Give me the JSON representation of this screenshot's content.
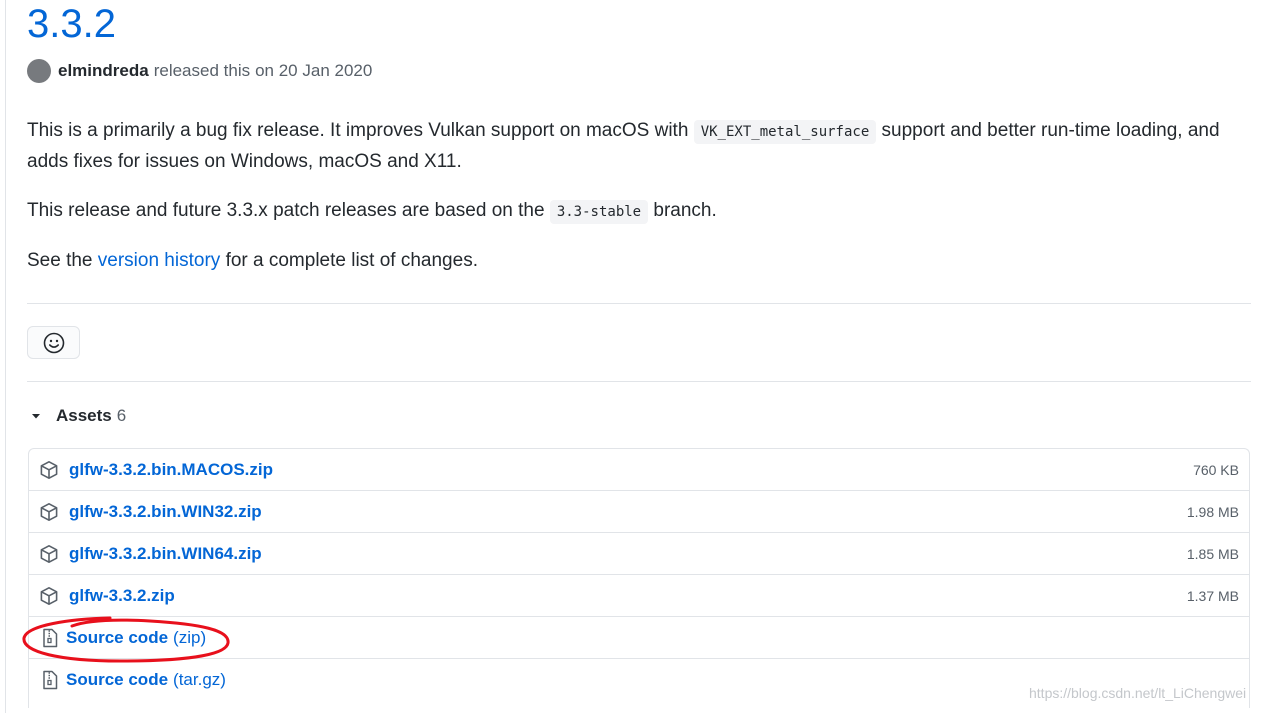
{
  "release": {
    "title": "3.3.2",
    "author": "elmindreda",
    "released_text": "released this",
    "released_date": "on 20 Jan 2020"
  },
  "notes": {
    "p1_before": "This is a primarily a bug fix release. It improves Vulkan support on macOS with",
    "p1_code": "VK_EXT_metal_surface",
    "p1_after": "support and better run-time loading, and adds fixes for issues on Windows, macOS and X11.",
    "p2_before": "This release and future 3.3.x patch releases are based on the",
    "p2_code": "3.3-stable",
    "p2_after": "branch.",
    "p3_before": "See the",
    "p3_link": "version history",
    "p3_after": "for a complete list of changes."
  },
  "assets": {
    "title": "Assets",
    "count": "6",
    "items": [
      {
        "name": "glfw-3.3.2.bin.MACOS.zip",
        "size": "760 KB",
        "icon": "package-icon"
      },
      {
        "name": "glfw-3.3.2.bin.WIN32.zip",
        "size": "1.98 MB",
        "icon": "package-icon"
      },
      {
        "name": "glfw-3.3.2.bin.WIN64.zip",
        "size": "1.85 MB",
        "icon": "package-icon"
      },
      {
        "name": "glfw-3.3.2.zip",
        "size": "1.37 MB",
        "icon": "package-icon"
      }
    ],
    "source": [
      {
        "name": "Source code",
        "ext": "(zip)",
        "icon": "file-zip-icon"
      },
      {
        "name": "Source code",
        "ext": "(tar.gz)",
        "icon": "file-zip-icon"
      }
    ]
  },
  "annotation": {
    "color": "#e8101c"
  },
  "watermark": "https://blog.csdn.net/lt_LiChengwei",
  "colors": {
    "link": "#0366d6",
    "text": "#24292e",
    "muted": "#586069",
    "border": "#e1e4e8"
  }
}
